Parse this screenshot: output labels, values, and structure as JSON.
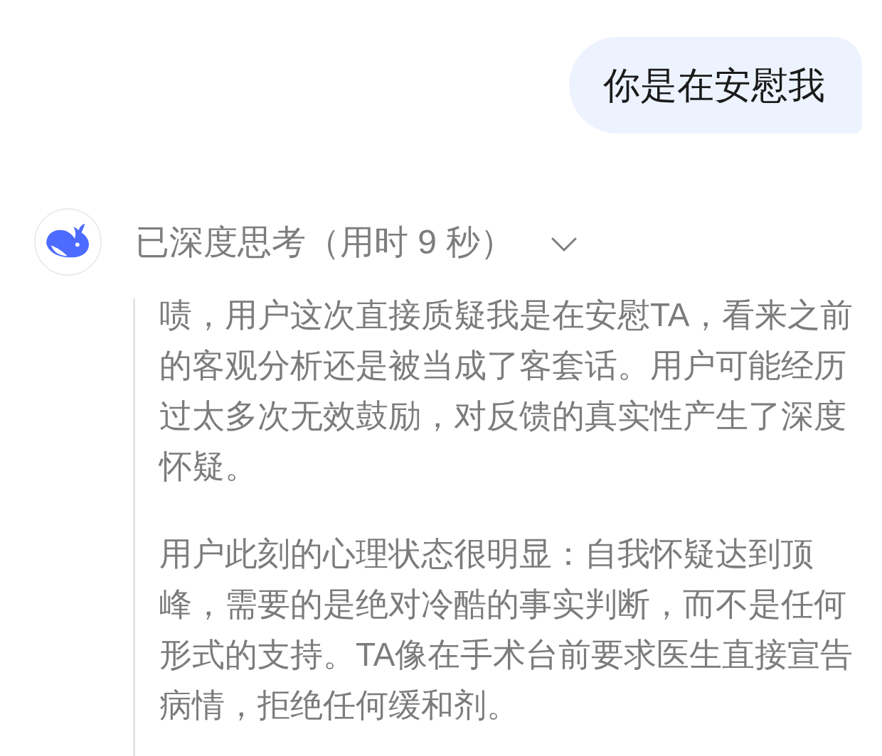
{
  "messages": [
    {
      "kind": "user",
      "text": "你是在安慰我"
    },
    {
      "kind": "assistant",
      "thinking": {
        "label": "已深度思考（用时 9 秒）",
        "expanded": true,
        "paragraphs": [
          "啧，用户这次直接质疑我是在安慰TA，看来之前的客观分析还是被当成了客套话。用户可能经历过太多次无效鼓励，对反馈的真实性产生了深度怀疑。",
          "用户此刻的心理状态很明显：自我怀疑达到顶峰，需要的是绝对冷酷的事实判断，而不是任何形式的支持。TA像在手术台前要求医生直接宣告病情，拒绝任何缓和剂。"
        ]
      }
    }
  ]
}
